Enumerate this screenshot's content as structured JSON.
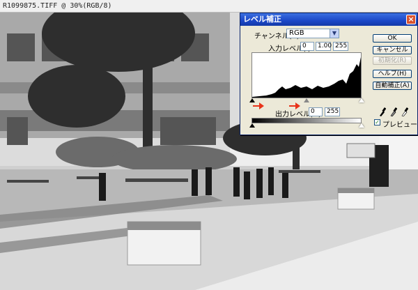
{
  "document": {
    "title": "R1099875.TIFF @ 30%(RGB/8)"
  },
  "dialog": {
    "title": "レベル補正",
    "channel_label": "チャンネル(C):",
    "channel_value": "RGB",
    "input_levels_label": "入力レベル(I):",
    "input_levels": [
      "0",
      "1.00",
      "255"
    ],
    "output_levels_label": "出力レベル(O):",
    "output_levels": [
      "0",
      "255"
    ],
    "buttons": {
      "ok": "OK",
      "cancel": "キャンセル",
      "reset": "初期化(R)",
      "help": "ヘルプ(H)",
      "auto": "自動補正(A)"
    },
    "preview_label": "プレビュー(P)",
    "preview_checked": true
  },
  "colors": {
    "annotation_arrow": "#e8331a",
    "titlebar": "#1b47c7"
  }
}
